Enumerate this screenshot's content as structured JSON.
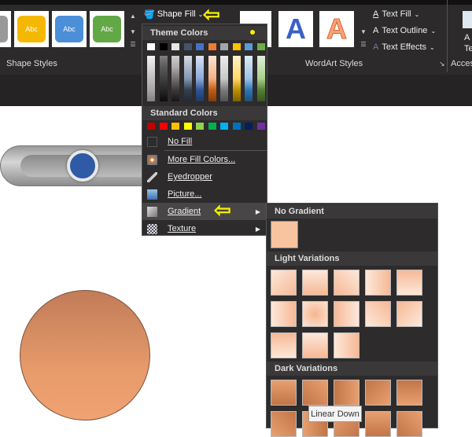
{
  "ribbon": {
    "shape_styles_label": "Shape Styles",
    "style_thumbs": [
      {
        "label": "Abc",
        "color": "#f5b800"
      },
      {
        "label": "Abc",
        "color": "#4a8fd8"
      },
      {
        "label": "Abc",
        "color": "#62a846"
      }
    ],
    "shape_fill_label": "Shape Fill",
    "wordart_label": "WordArt Styles",
    "wordart_letter": "A",
    "text_fill": "Text Fill",
    "text_outline": "Text Outline",
    "text_effects": "Text Effects",
    "access_label": "Access",
    "alt_text_partial": "A",
    "alt_text_partial2": "Te"
  },
  "menu": {
    "theme_header": "Theme Colors",
    "theme_colors": [
      "#ffffff",
      "#000000",
      "#e7e6e6",
      "#44546a",
      "#4472c4",
      "#ed7d31",
      "#a5a5a5",
      "#ffc000",
      "#5b9bd5",
      "#70ad47"
    ],
    "standard_header": "Standard Colors",
    "standard_colors": [
      "#c00000",
      "#ff0000",
      "#ffc000",
      "#ffff00",
      "#92d050",
      "#00b050",
      "#00b0f0",
      "#0070c0",
      "#002060",
      "#7030a0"
    ],
    "items": [
      {
        "label": "No Fill",
        "icon": "no-fill-icon"
      },
      {
        "label": "More Fill Colors...",
        "icon": "color-wheel-icon"
      },
      {
        "label": "Eyedropper",
        "icon": "eyedropper-icon"
      },
      {
        "label": "Picture...",
        "icon": "picture-icon"
      },
      {
        "label": "Gradient",
        "icon": "gradient-icon",
        "submenu": true,
        "highlighted": true
      },
      {
        "label": "Texture",
        "icon": "texture-icon",
        "submenu": true
      }
    ]
  },
  "submenu": {
    "no_gradient": "No Gradient",
    "light_variations": "Light Variations",
    "dark_variations": "Dark Variations",
    "base_color": "#f8c4a0"
  },
  "tooltip": "Linear Down",
  "annotation_color": "#f5f000"
}
